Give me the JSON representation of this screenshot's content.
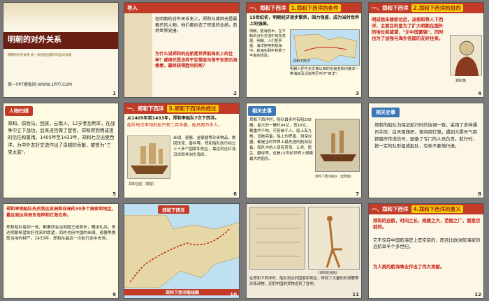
{
  "slides": [
    {
      "num": "1",
      "title": "明朝的对外关系",
      "subtitle": "明朝的对外关系 统一多民族国家的巩固与发展",
      "footer": "第一PPT模板网-WWW.1PPT.COM"
    },
    {
      "num": "2",
      "header": "导入",
      "text_a": "在明朝的对外关系史上，郑和与戚继光是最著名的人物，他们都创造了辉煌的业绩，彪炳世界史册。",
      "text_b": "为什么说郑和的远航是世界航海史上的壮举？戚继光是怎样平定倭寇与荡平东南沿海倭患，最终获得胜利的呢？"
    },
    {
      "num": "3",
      "tab1": "一、郑和下西洋",
      "tab2": "1.郑和下西洋的条件",
      "text_a": "15世纪初，明朝经济逐步繁荣，国力强盛，成为当时世界上的强国。",
      "text_b": "明朝，航海技术，在不断的对外交流中有所发展。明朝，人们把罗盘、海洋使用到航海中，航海实践中积累了丰富的经验。",
      "text_c": "明朝人把今天文莱以西的东南亚和印度洋一带海域及沿岸地区叫作\"西洋\"。",
      "map_label": "郑和下西洋"
    },
    {
      "num": "4",
      "tab1": "一、郑和下西洋",
      "tab2": "2.郑和下西洋的目的",
      "text_a": "明成祖朱棣即位后，派郑和等人下西洋，主要目的是为了扩大明朝在国外的地位和威望，\"示中国富强\"，同时也为了加强与海外各国的友好往来。",
      "caption": "郑和像"
    },
    {
      "num": "5",
      "header": "人物扫描",
      "text_a": "郑和，原姓马，回族，云南人。12岁参加明军，在战争中立下战功，后来进宫做了宦官。郑和得到明成祖的信任和重用。1405年至1433年，郑和七次出使西洋，为中外友好交流作出了卓越的贡献，被誉为\"三宝太监\"。"
    },
    {
      "num": "6",
      "tab1": "一、郑和下西洋",
      "tab2": "3.郑和下西洋的经过",
      "text_a": "从1405年到1433年，郑和率船队7次下西洋。",
      "text_b": "船队每次率领的船只有二百多艘，船员两万多人。",
      "text_c": "丝绸、瓷器、金银器等珍贵物品，换回珠宝、香料等。郑和船队航行经过三十多个国家和地区，最远到达红海沿岸和非洲东海岸。",
      "caption": "郑和宝船（模型）"
    },
    {
      "num": "7",
      "header": "相关史事",
      "text_a": "郑和下西洋时，船队最多时有船208艘，最大的一艘长44丈，宽18丈，载重约千吨，可容纳千人，船上有九桅，设施完备。船上的罗盘、测深仪器，都是当时世界上最先进的航海设备。船队中的人员有官员、士兵、医生、翻译等。这是15世纪世界上规模最大的船队。",
      "caption": "郑和下西洋船队（复原图）"
    },
    {
      "num": "8",
      "header": "相关史事",
      "text_a": "郑和的船队为保证航行时的协调一致，采用了多种通讯手段：白天用旗帜，夜间用灯笼，遇到大雾天气用锣鼓声传递信号，配备了专门的人员负责。航行时，按一定的队形组成船队，有条不紊地行进。"
    },
    {
      "num": "9",
      "text_a": "郑和率领船队先后到达亚洲和非洲的30多个国家和地区，最远到达非洲东海岸和红海沿岸。",
      "text_b": "郑和船队每到一地，都要拜会当地国王或酋长，赠送礼品，表达明朝希望友好往来的愿望，同时也用中国的丝绸、瓷器等换取当地的特产。1433年，郑和在最后一次航行途中去世。"
    },
    {
      "num": "10",
      "tab1": "郑和下西洋",
      "caption": "郑和下西洋路线图"
    },
    {
      "num": "11",
      "caption": "《郑和航海图》",
      "text_a": "在郑和下西洋时，船队到达的国家和地区，带回了大量的长颈鹿等珍奇动物，还把中国的货物运到了各地。"
    },
    {
      "num": "12",
      "tab1": "一、郑和下西洋",
      "tab2": "4.郑和下西洋的意义",
      "text_a": "郑和的远航，时间之长，规模之大，范围之广，都是空前的。",
      "text_b": "它不仅在中国航海史上是空前的，而且比欧洲航海家的远航早半个多世纪，",
      "text_c": "为人类的航海事业作出了伟大贡献。"
    }
  ],
  "colors": {
    "accent": "#c33a27",
    "tag": "#f4d100"
  }
}
